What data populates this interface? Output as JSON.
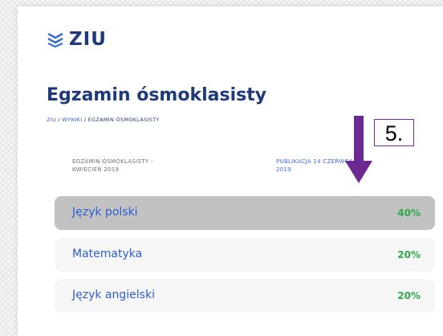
{
  "header": {
    "logo_text": "ZIU",
    "logo_icon": "ziu-logo-icon"
  },
  "page": {
    "title": "Egzamin ósmoklasisty",
    "breadcrumb": [
      {
        "label": "ZIU",
        "link": true
      },
      {
        "label": " / ",
        "link": false
      },
      {
        "label": "WYNIKI",
        "link": true
      },
      {
        "label": " / EGZAMIN ÓSMOKLASISTY",
        "link": false
      }
    ]
  },
  "exam": {
    "name_line1": "EGZAMIN ÓSMOKLASISTY -",
    "name_line2": "KWIECIEŃ 2019",
    "publication_line1": "PUBLIKACJA 14 CZERWCA",
    "publication_line2": "2019"
  },
  "subjects": [
    {
      "name": "Język polski",
      "score": "40%",
      "selected": true
    },
    {
      "name": "Matematyka",
      "score": "20%",
      "selected": false
    },
    {
      "name": "Język angielski",
      "score": "20%",
      "selected": false
    }
  ],
  "annotation": {
    "step_label": "5.",
    "arrow_color": "#6b2a91",
    "box_border_color": "#7a2a9a"
  },
  "colors": {
    "brand": "#1e3a7a",
    "link": "#2f5dd0",
    "score": "#2eaa4c",
    "selected_row": "#c2c2c2"
  }
}
